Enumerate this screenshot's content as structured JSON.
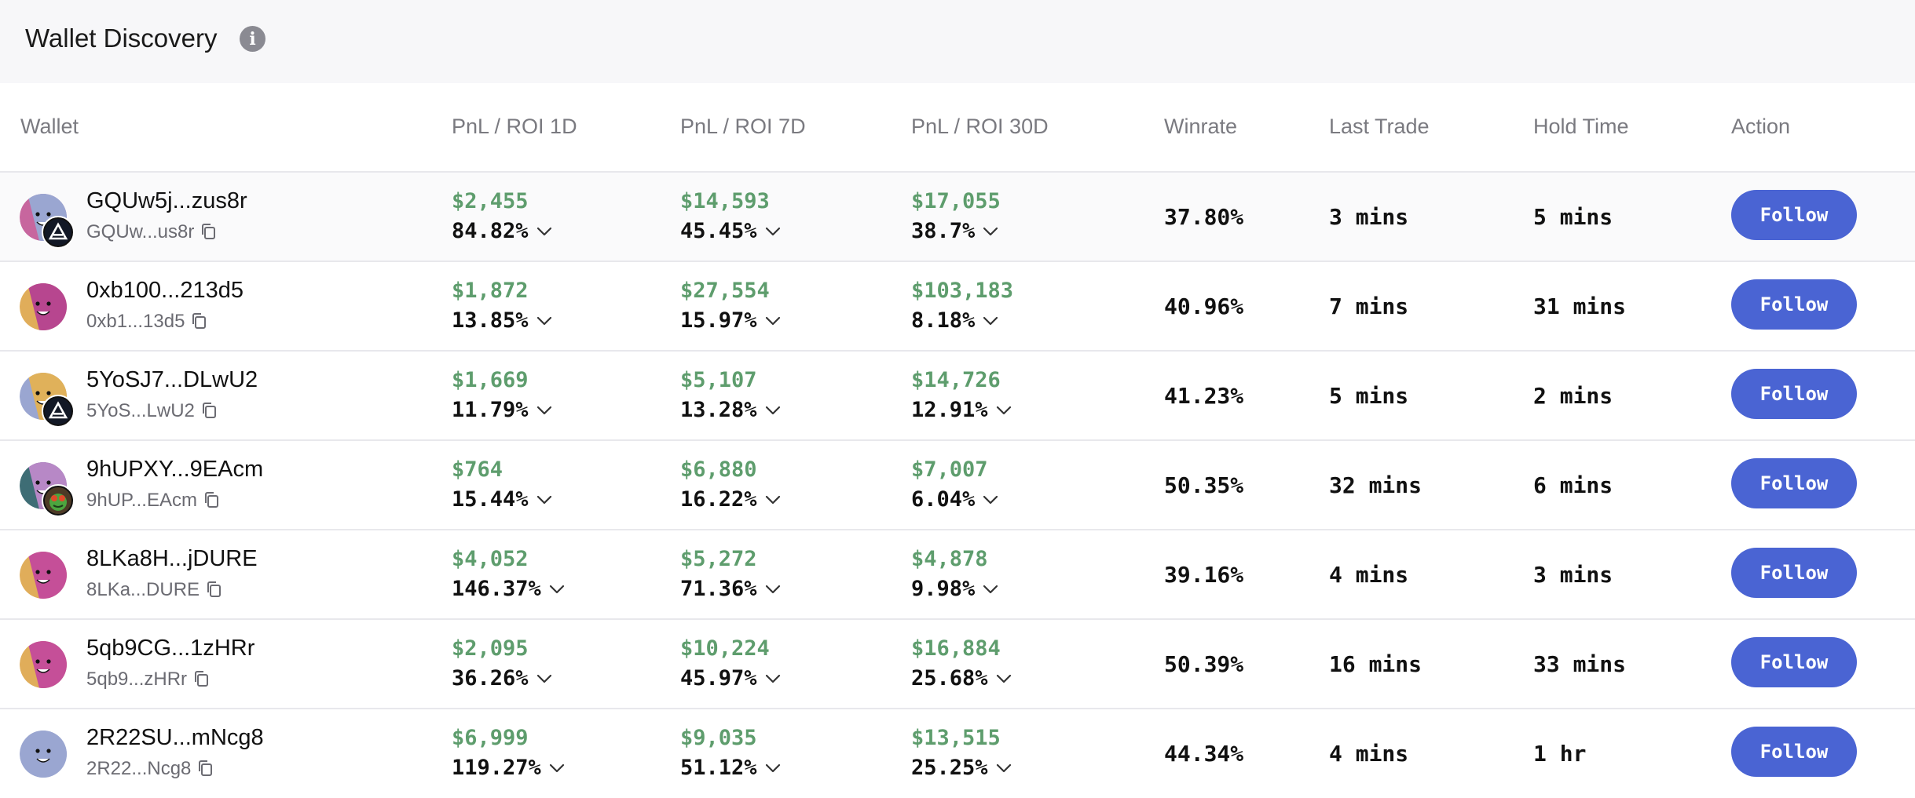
{
  "header": {
    "title": "Wallet Discovery",
    "info_icon": "info-icon"
  },
  "columns": {
    "wallet": "Wallet",
    "pnl_1d": "PnL / ROI 1D",
    "pnl_7d": "PnL / ROI 7D",
    "pnl_30d": "PnL / ROI 30D",
    "winrate": "Winrate",
    "last_trade": "Last Trade",
    "hold_time": "Hold Time",
    "action": "Action"
  },
  "colors": {
    "positive": "#5e9d6d",
    "button": "#4a64d3",
    "header_bg": "#f7f7f9"
  },
  "rows": [
    {
      "name": "GQUw5j...zus8r",
      "short": "GQUw...us8r",
      "pnl_1d": "$2,455",
      "roi_1d": "84.82%",
      "pnl_7d": "$14,593",
      "roi_7d": "45.45%",
      "pnl_30d": "$17,055",
      "roi_30d": "38.7%",
      "winrate": "37.80%",
      "last_trade": "3 mins",
      "hold_time": "5 mins",
      "action": "Follow"
    },
    {
      "name": "0xb100...213d5",
      "short": "0xb1...13d5",
      "pnl_1d": "$1,872",
      "roi_1d": "13.85%",
      "pnl_7d": "$27,554",
      "roi_7d": "15.97%",
      "pnl_30d": "$103,183",
      "roi_30d": "8.18%",
      "winrate": "40.96%",
      "last_trade": "7 mins",
      "hold_time": "31 mins",
      "action": "Follow"
    },
    {
      "name": "5YoSJ7...DLwU2",
      "short": "5YoS...LwU2",
      "pnl_1d": "$1,669",
      "roi_1d": "11.79%",
      "pnl_7d": "$5,107",
      "roi_7d": "13.28%",
      "pnl_30d": "$14,726",
      "roi_30d": "12.91%",
      "winrate": "41.23%",
      "last_trade": "5 mins",
      "hold_time": "2 mins",
      "action": "Follow"
    },
    {
      "name": "9hUPXY...9EAcm",
      "short": "9hUP...EAcm",
      "pnl_1d": "$764",
      "roi_1d": "15.44%",
      "pnl_7d": "$6,880",
      "roi_7d": "16.22%",
      "pnl_30d": "$7,007",
      "roi_30d": "6.04%",
      "winrate": "50.35%",
      "last_trade": "32 mins",
      "hold_time": "6 mins",
      "action": "Follow"
    },
    {
      "name": "8LKa8H...jDURE",
      "short": "8LKa...DURE",
      "pnl_1d": "$4,052",
      "roi_1d": "146.37%",
      "pnl_7d": "$5,272",
      "roi_7d": "71.36%",
      "pnl_30d": "$4,878",
      "roi_30d": "9.98%",
      "winrate": "39.16%",
      "last_trade": "4 mins",
      "hold_time": "3 mins",
      "action": "Follow"
    },
    {
      "name": "5qb9CG...1zHRr",
      "short": "5qb9...zHRr",
      "pnl_1d": "$2,095",
      "roi_1d": "36.26%",
      "pnl_7d": "$10,224",
      "roi_7d": "45.97%",
      "pnl_30d": "$16,884",
      "roi_30d": "25.68%",
      "winrate": "50.39%",
      "last_trade": "16 mins",
      "hold_time": "33 mins",
      "action": "Follow"
    },
    {
      "name": "2R22SU...mNcg8",
      "short": "2R22...Ncg8",
      "pnl_1d": "$6,999",
      "roi_1d": "119.27%",
      "pnl_7d": "$9,035",
      "roi_7d": "51.12%",
      "pnl_30d": "$13,515",
      "roi_30d": "25.25%",
      "winrate": "44.34%",
      "last_trade": "4 mins",
      "hold_time": "1 hr",
      "action": "Follow"
    }
  ]
}
